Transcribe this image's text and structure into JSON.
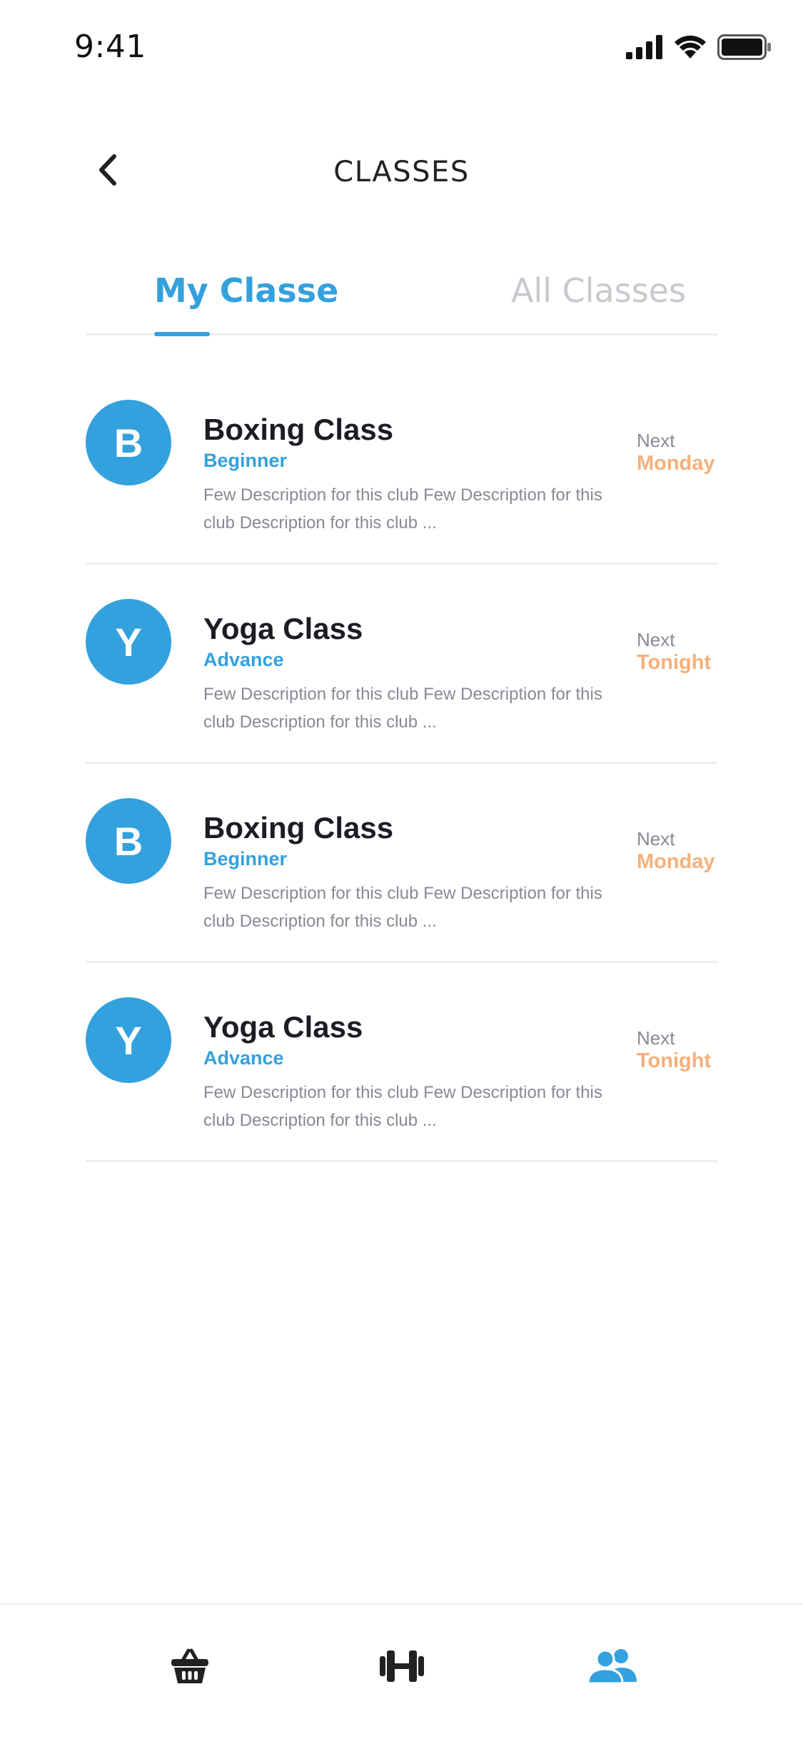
{
  "status_bar": {
    "time": "9:41"
  },
  "header": {
    "title": "CLASSES",
    "back_icon": "chevron-left-icon"
  },
  "tabs": [
    {
      "label": "My Classe",
      "active": true
    },
    {
      "label": "All Classes",
      "active": false
    }
  ],
  "classes": [
    {
      "initial": "B",
      "name": "Boxing Class",
      "level": "Beginner",
      "description": "Few Description for this club Few Description for this club Description for this club ...",
      "next_label": "Next",
      "next_day": "Monday"
    },
    {
      "initial": "Y",
      "name": "Yoga Class",
      "level": "Advance",
      "description": "Few Description for this club Few Description for this club Description for this club ...",
      "next_label": "Next",
      "next_day": "Tonight"
    },
    {
      "initial": "B",
      "name": "Boxing Class",
      "level": "Beginner",
      "description": "Few Description for this club Few Description for this club Description for this club ...",
      "next_label": "Next",
      "next_day": "Monday"
    },
    {
      "initial": "Y",
      "name": "Yoga Class",
      "level": "Advance",
      "description": "Few Description for this club Few Description for this club Description for this club ...",
      "next_label": "Next",
      "next_day": "Tonight"
    }
  ],
  "bottom_nav": [
    {
      "icon": "shopping-basket-icon",
      "active": false
    },
    {
      "icon": "dumbbell-icon",
      "active": false
    },
    {
      "icon": "users-icon",
      "active": true
    }
  ],
  "colors": {
    "accent": "#33a1de",
    "next_day": "#f5b07a",
    "muted": "#868a94",
    "inactive_tab": "#c7c9cf"
  }
}
